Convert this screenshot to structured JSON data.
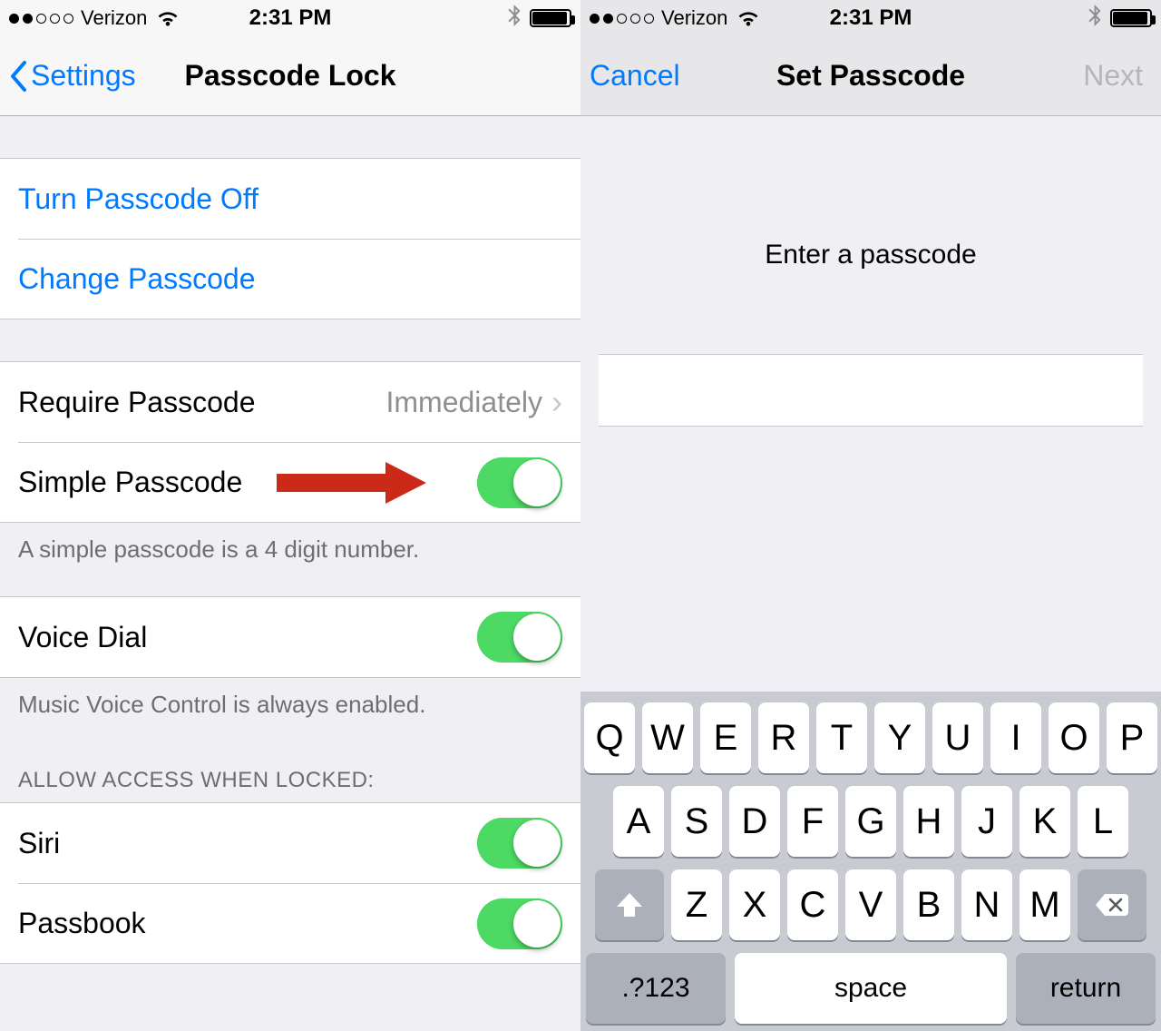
{
  "status": {
    "carrier": "Verizon",
    "time": "2:31 PM",
    "signal_filled": 2,
    "signal_total": 5
  },
  "left": {
    "nav": {
      "back": "Settings",
      "title": "Passcode Lock"
    },
    "actions": {
      "turn_off": "Turn Passcode Off",
      "change": "Change Passcode"
    },
    "require": {
      "label": "Require Passcode",
      "value": "Immediately"
    },
    "simple": {
      "label": "Simple Passcode",
      "footer": "A simple passcode is a 4 digit number."
    },
    "voice": {
      "label": "Voice Dial",
      "footer": "Music Voice Control is always enabled."
    },
    "allow": {
      "heading": "ALLOW ACCESS WHEN LOCKED:",
      "siri": "Siri",
      "passbook": "Passbook"
    }
  },
  "right": {
    "nav": {
      "cancel": "Cancel",
      "title": "Set Passcode",
      "next": "Next"
    },
    "prompt": "Enter a passcode",
    "keyboard": {
      "row1": [
        "Q",
        "W",
        "E",
        "R",
        "T",
        "Y",
        "U",
        "I",
        "O",
        "P"
      ],
      "row2": [
        "A",
        "S",
        "D",
        "F",
        "G",
        "H",
        "J",
        "K",
        "L"
      ],
      "row3": [
        "Z",
        "X",
        "C",
        "V",
        "B",
        "N",
        "M"
      ],
      "switch": ".?123",
      "space": "space",
      "return": "return"
    }
  }
}
